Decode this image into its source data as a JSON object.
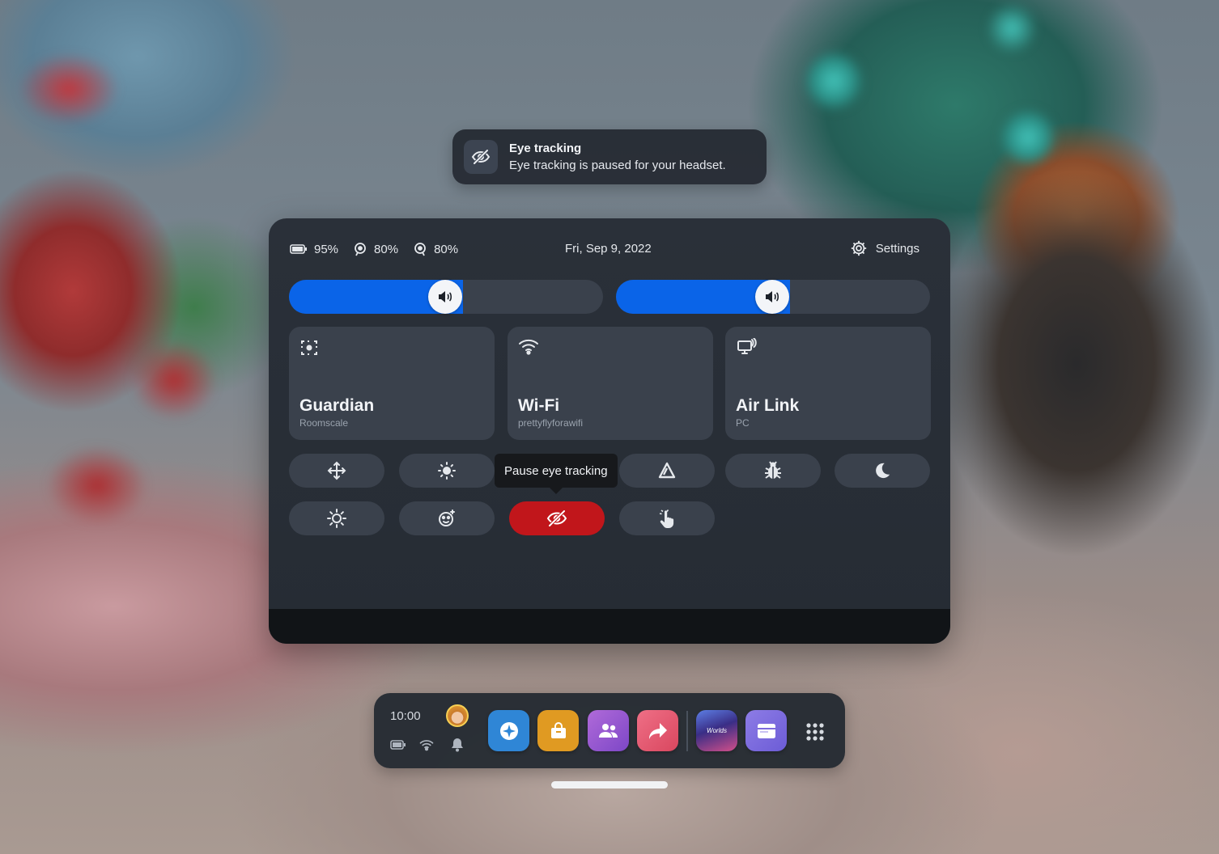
{
  "toast": {
    "title": "Eye tracking",
    "message": "Eye tracking is paused for your headset.",
    "icon": "eye-off-icon"
  },
  "status": {
    "headset_battery": "95%",
    "left_controller": "80%",
    "right_controller": "80%",
    "date": "Fri, Sep 9, 2022",
    "settings_label": "Settings"
  },
  "sliders": [
    {
      "name": "volume",
      "icon": "speaker-icon",
      "level": 0.5
    },
    {
      "name": "volume",
      "icon": "speaker-icon",
      "level": 0.5
    }
  ],
  "tiles": [
    {
      "title": "Guardian",
      "subtitle": "Roomscale",
      "icon": "guardian-icon"
    },
    {
      "title": "Wi-Fi",
      "subtitle": "prettyflyforawifi",
      "icon": "wifi-icon"
    },
    {
      "title": "Air Link",
      "subtitle": "PC",
      "icon": "air-link-icon"
    }
  ],
  "quick_actions": {
    "tooltip": "Pause eye tracking",
    "buttons": [
      "move-icon",
      "brightness-icon",
      "eye-tracking-icon",
      "triangle-icon",
      "bug-icon",
      "moon-icon",
      "sun-outline-icon",
      "face-icon",
      "eye-off-icon",
      "hand-pointer-icon"
    ],
    "active": "eye-off-icon",
    "active_color": "#c1161b"
  },
  "dock": {
    "time": "10:00",
    "apps": [
      {
        "name": "explore",
        "color": "#2f86d6"
      },
      {
        "name": "store",
        "color": "#e09a22"
      },
      {
        "name": "people",
        "color": "#9a55cf"
      },
      {
        "name": "share",
        "color": "#e05a77"
      },
      {
        "name": "worlds",
        "label": "Worlds",
        "color": "#3a3a8a"
      },
      {
        "name": "browser",
        "color": "#7e6bdc"
      }
    ]
  },
  "colors": {
    "accent_blue": "#0a64e8",
    "panel_bg": "#2a3039",
    "tile_bg": "#3a414c"
  }
}
